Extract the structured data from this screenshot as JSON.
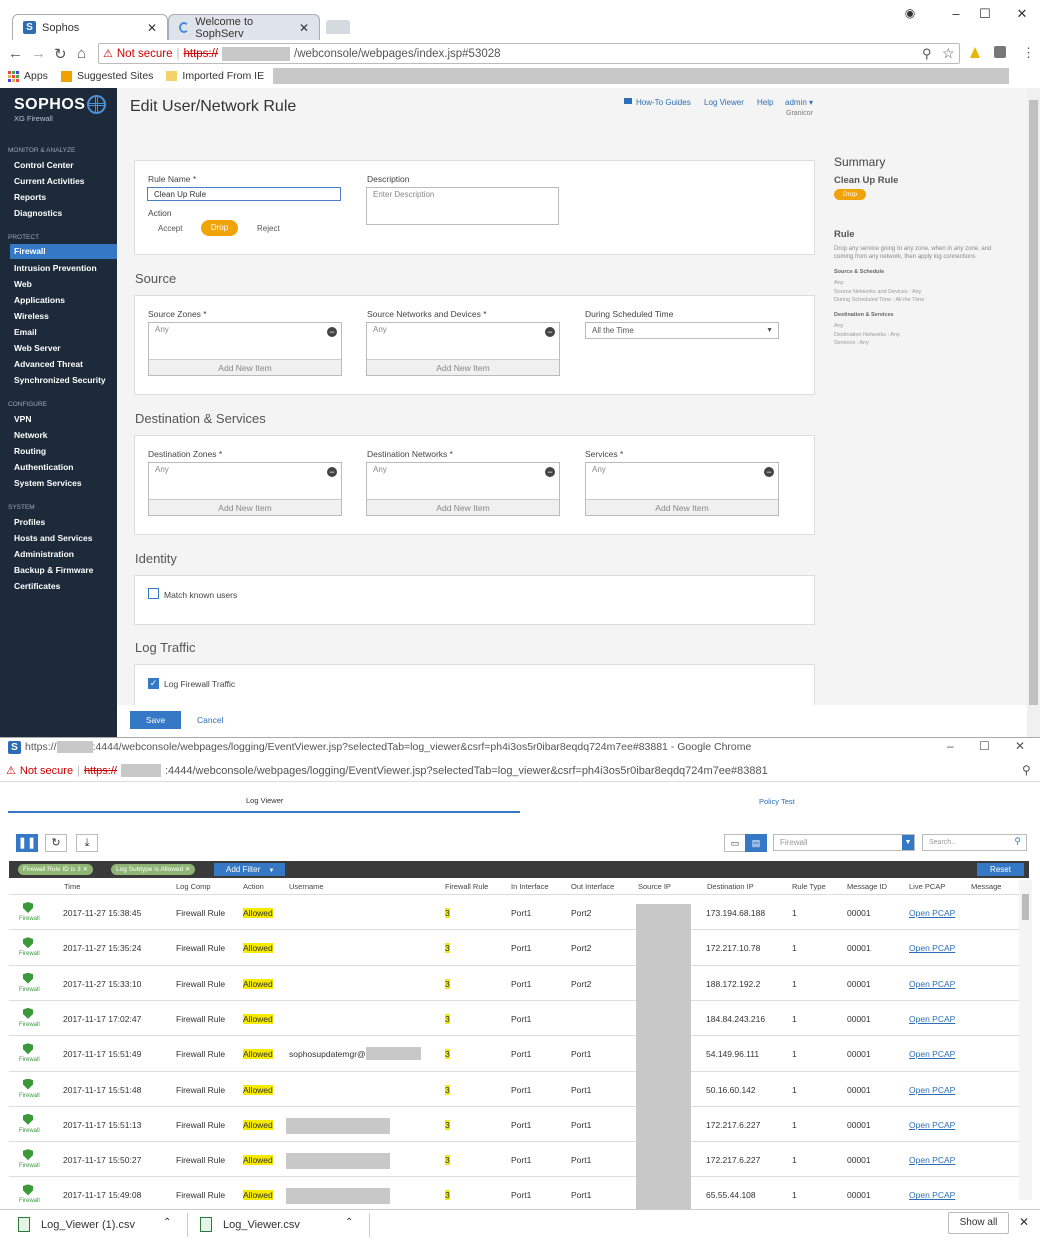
{
  "browser1": {
    "tabs": [
      {
        "label": "Sophos"
      },
      {
        "label": "Welcome to SophServ"
      }
    ],
    "not_secure": "Not secure",
    "https": "https://",
    "url_rest": "/webconsole/webpages/index.jsp#53028",
    "bookmarks": [
      "Apps",
      "Suggested Sites",
      "Imported From IE"
    ]
  },
  "sidebar": {
    "logo": "SOPHOS",
    "logo_sub": "XG Firewall",
    "sections": [
      {
        "title": "MONITOR & ANALYZE",
        "items": [
          "Control Center",
          "Current Activities",
          "Reports",
          "Diagnostics"
        ]
      },
      {
        "title": "PROTECT",
        "items": [
          "Firewall",
          "Intrusion Prevention",
          "Web",
          "Applications",
          "Wireless",
          "Email",
          "Web Server",
          "Advanced Threat",
          "Synchronized Security"
        ]
      },
      {
        "title": "CONFIGURE",
        "items": [
          "VPN",
          "Network",
          "Routing",
          "Authentication",
          "System Services"
        ]
      },
      {
        "title": "SYSTEM",
        "items": [
          "Profiles",
          "Hosts and Services",
          "Administration",
          "Backup & Firmware",
          "Certificates"
        ]
      }
    ]
  },
  "header": {
    "title": "Edit User/Network Rule",
    "links": [
      "How-To Guides",
      "Log Viewer",
      "Help"
    ],
    "user": "admin",
    "org": "Granicor"
  },
  "form": {
    "rule_name_label": "Rule Name *",
    "rule_name_value": "Clean Up Rule",
    "description_label": "Description",
    "description_placeholder": "Enter Description",
    "action_label": "Action",
    "actions": [
      "Accept",
      "Drop",
      "Reject"
    ],
    "source_title": "Source",
    "source_zones_label": "Source Zones *",
    "source_networks_label": "Source Networks and Devices *",
    "schedule_label": "During Scheduled Time",
    "schedule_value": "All the Time",
    "dest_title": "Destination & Services",
    "dest_zones_label": "Destination Zones *",
    "dest_networks_label": "Destination Networks *",
    "services_label": "Services *",
    "any": "Any",
    "add_new_item": "Add New Item",
    "identity_title": "Identity",
    "match_known_users": "Match known users",
    "log_traffic_title": "Log Traffic",
    "log_firewall_traffic": "Log Firewall Traffic",
    "save": "Save",
    "cancel": "Cancel"
  },
  "summary": {
    "title": "Summary",
    "rule_name": "Clean Up Rule",
    "badge": "Drop",
    "rule_heading": "Rule",
    "rule_desc": "Drop any service going to any zone, when in any zone, and coming from any network, then apply log connections",
    "src_heading": "Source & Schedule",
    "src_lines": [
      "Any",
      "Source Networks and Devices : Any",
      "During Scheduled Time : All the Time"
    ],
    "dst_heading": "Destination & Services",
    "dst_lines": [
      "Any",
      "Destination Networks : Any",
      "Services : Any"
    ]
  },
  "browser2": {
    "title_prefix": "https://",
    "title_rest": ":4444/webconsole/webpages/logging/EventViewer.jsp?selectedTab=log_viewer&csrf=ph4i3os5r0ibar8eqdq724m7ee#83881 - Google Chrome",
    "not_secure": "Not secure",
    "https": "https://",
    "url_rest": ":4444/webconsole/webpages/logging/EventViewer.jsp?selectedTab=log_viewer&csrf=ph4i3os5r0ibar8eqdq724m7ee#83881"
  },
  "logviewer": {
    "tabs": [
      "Log Viewer",
      "Policy Test"
    ],
    "module_select": "Firewall",
    "search_placeholder": "Search...",
    "chips": [
      "Firewall Rule ID is 3",
      "Log Subtype is Allowed"
    ],
    "add_filter": "Add Filter",
    "reset": "Reset",
    "columns": [
      "Time",
      "Log Comp",
      "Action",
      "Username",
      "Firewall Rule",
      "In Interface",
      "Out Interface",
      "Source IP",
      "Destination IP",
      "Rule Type",
      "Message ID",
      "Live PCAP",
      "Message"
    ],
    "icon_label": "Firewall",
    "rows": [
      {
        "time": "2017-11-27 15:38:45",
        "comp": "Firewall Rule",
        "action": "Allowed",
        "user": "",
        "rule": "3",
        "in": "Port1",
        "out": "Port2",
        "dst": "173.194.68.188",
        "type": "1",
        "msgid": "00001",
        "pcap": "Open PCAP"
      },
      {
        "time": "2017-11-27 15:35:24",
        "comp": "Firewall Rule",
        "action": "Allowed",
        "user": "",
        "rule": "3",
        "in": "Port1",
        "out": "Port2",
        "dst": "172.217.10.78",
        "type": "1",
        "msgid": "00001",
        "pcap": "Open PCAP"
      },
      {
        "time": "2017-11-27 15:33:10",
        "comp": "Firewall Rule",
        "action": "Allowed",
        "user": "",
        "rule": "3",
        "in": "Port1",
        "out": "Port2",
        "dst": "188.172.192.2",
        "type": "1",
        "msgid": "00001",
        "pcap": "Open PCAP"
      },
      {
        "time": "2017-11-17 17:02:47",
        "comp": "Firewall Rule",
        "action": "Allowed",
        "user": "",
        "rule": "3",
        "in": "Port1",
        "out": "",
        "dst": "184.84.243.216",
        "type": "1",
        "msgid": "00001",
        "pcap": "Open PCAP"
      },
      {
        "time": "2017-11-17 15:51:49",
        "comp": "Firewall Rule",
        "action": "Allowed",
        "user": "sophosupdatemgr@",
        "rule": "3",
        "in": "Port1",
        "out": "Port1",
        "dst": "54.149.96.111",
        "type": "1",
        "msgid": "00001",
        "pcap": "Open PCAP"
      },
      {
        "time": "2017-11-17 15:51:48",
        "comp": "Firewall Rule",
        "action": "Allowed",
        "user": "",
        "rule": "3",
        "in": "Port1",
        "out": "Port1",
        "dst": "50.16.60.142",
        "type": "1",
        "msgid": "00001",
        "pcap": "Open PCAP"
      },
      {
        "time": "2017-11-17 15:51:13",
        "comp": "Firewall Rule",
        "action": "Allowed",
        "user": "",
        "rule": "3",
        "in": "Port1",
        "out": "Port1",
        "dst": "172.217.6.227",
        "type": "1",
        "msgid": "00001",
        "pcap": "Open PCAP"
      },
      {
        "time": "2017-11-17 15:50:27",
        "comp": "Firewall Rule",
        "action": "Allowed",
        "user": "",
        "rule": "3",
        "in": "Port1",
        "out": "Port1",
        "dst": "172.217.6.227",
        "type": "1",
        "msgid": "00001",
        "pcap": "Open PCAP"
      },
      {
        "time": "2017-11-17 15:49:08",
        "comp": "Firewall Rule",
        "action": "Allowed",
        "user": "",
        "rule": "3",
        "in": "Port1",
        "out": "Port1",
        "dst": "65.55.44.108",
        "type": "1",
        "msgid": "00001",
        "pcap": "Open PCAP"
      }
    ]
  },
  "downloads": {
    "files": [
      "Log_Viewer (1).csv",
      "Log_Viewer.csv"
    ],
    "show_all": "Show all"
  },
  "colors": {
    "sidebar": "#1c2a3a",
    "accent_blue": "#3478c6",
    "drop_orange": "#f0a30a",
    "allowed_yellow": "#f5ea00",
    "shield_green": "#3a9a3a"
  }
}
